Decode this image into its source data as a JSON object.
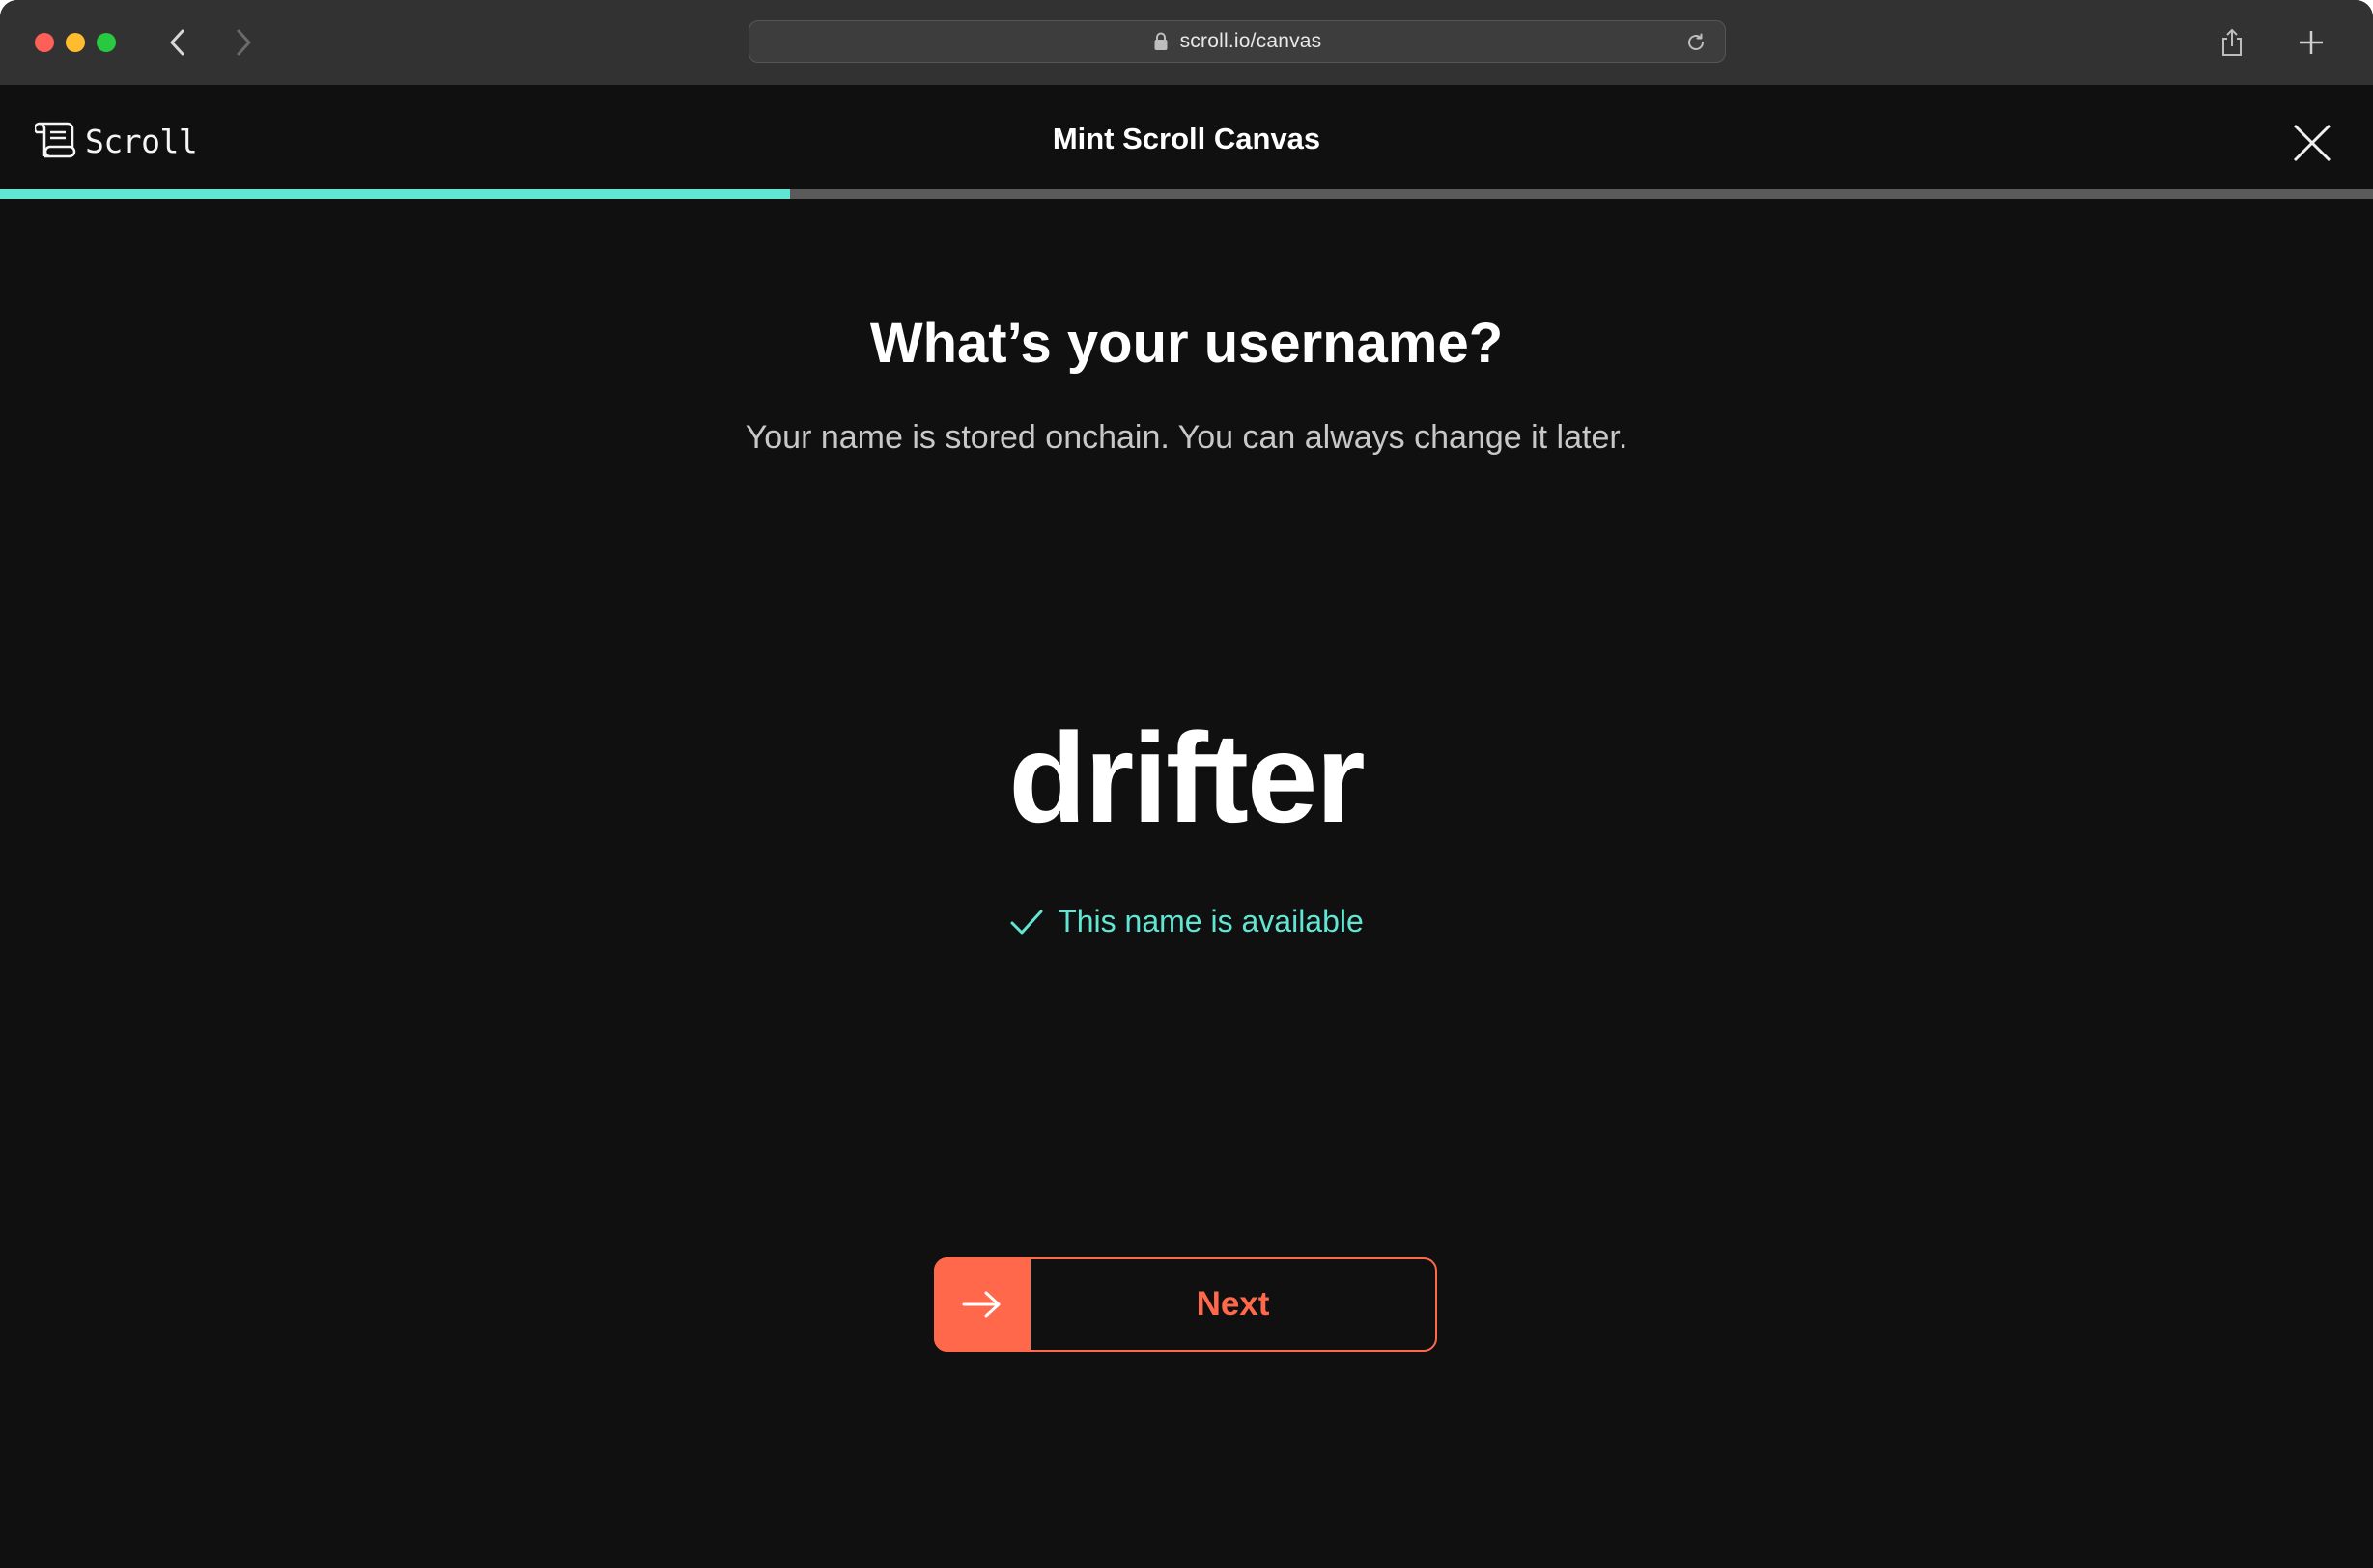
{
  "browser": {
    "url": "scroll.io/canvas",
    "icons": {
      "back": "chevron-left-icon",
      "forward": "chevron-right-icon",
      "lock": "lock-icon",
      "reload": "reload-icon",
      "share": "share-icon",
      "new_tab": "plus-icon"
    }
  },
  "header": {
    "logo_text": "Scroll",
    "title": "Mint Scroll Canvas",
    "close_icon": "close-icon"
  },
  "progress": {
    "value": 0.333,
    "fill_color": "#62e6d4",
    "track_color": "#5a5a5a"
  },
  "main": {
    "heading": "What’s your username?",
    "subheading": "Your name is stored onchain. You can always change it later.",
    "username_value": "drifter",
    "status_text": "This name is available",
    "status_color": "#62e6d4",
    "next_label": "Next",
    "accent_color": "#ff684b"
  }
}
